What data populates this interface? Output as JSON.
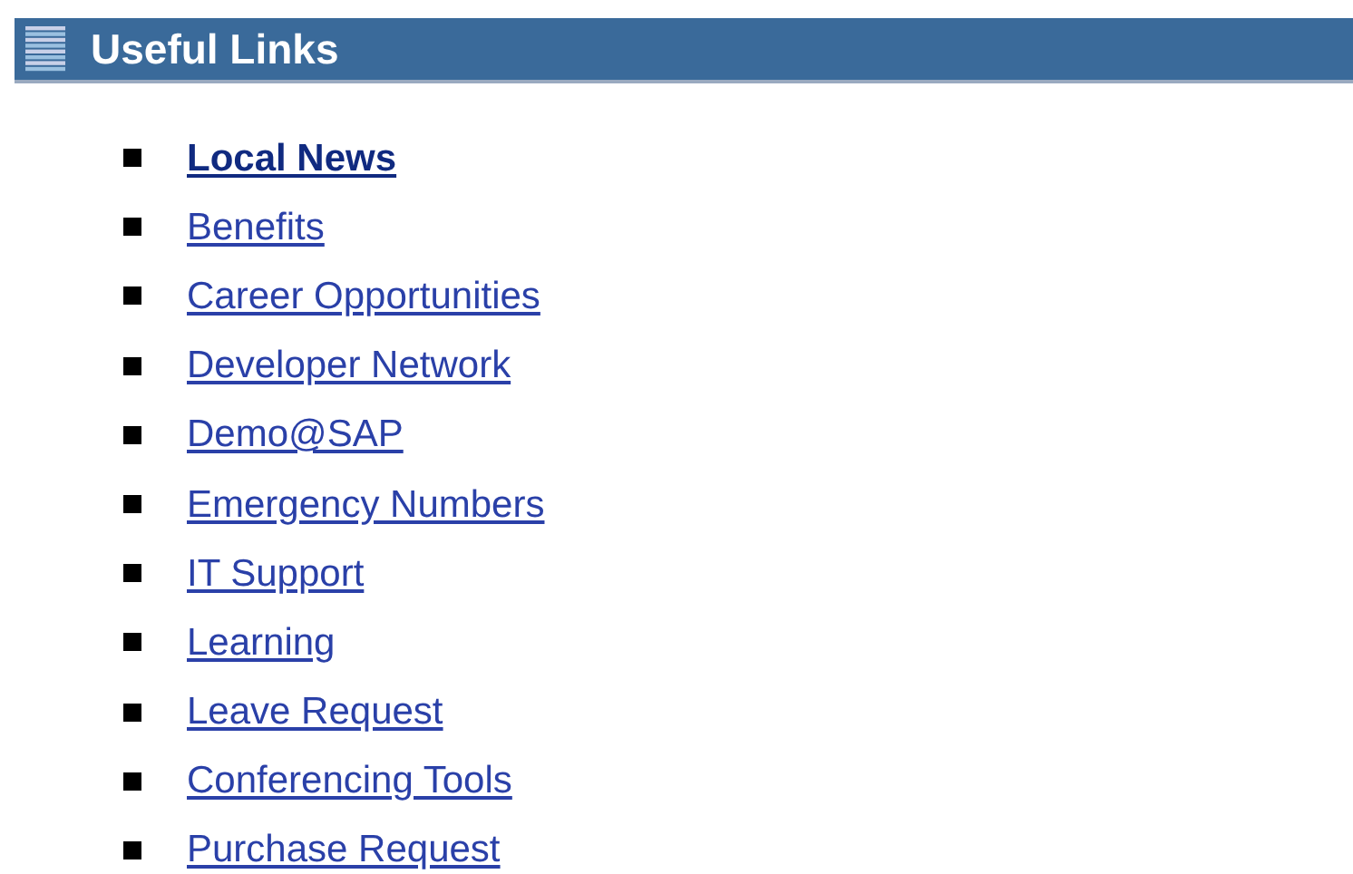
{
  "header": {
    "title": "Useful Links"
  },
  "links": [
    {
      "label": "Local News",
      "selected": true
    },
    {
      "label": "Benefits",
      "selected": false
    },
    {
      "label": "Career Opportunities",
      "selected": false
    },
    {
      "label": "Developer Network",
      "selected": false
    },
    {
      "label": "Demo@SAP",
      "selected": false
    },
    {
      "label": "Emergency Numbers",
      "selected": false
    },
    {
      "label": "IT Support",
      "selected": false
    },
    {
      "label": "Learning",
      "selected": false
    },
    {
      "label": "Leave Request",
      "selected": false
    },
    {
      "label": "Conferencing Tools",
      "selected": false
    },
    {
      "label": "Purchase Request",
      "selected": false
    }
  ]
}
